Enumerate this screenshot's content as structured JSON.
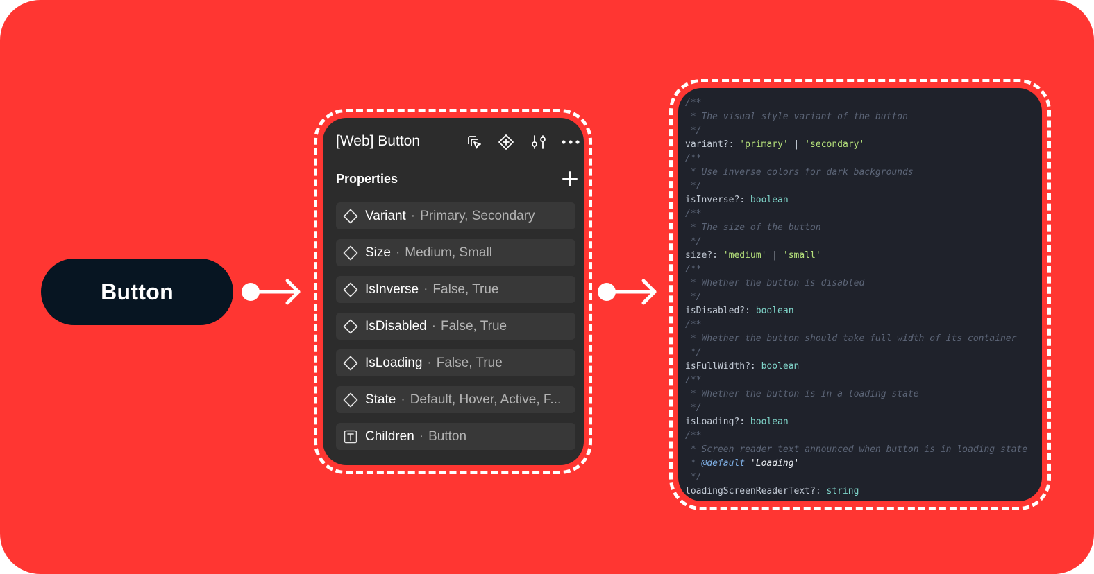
{
  "colors": {
    "background": "#ff3632",
    "button_bg": "#071522",
    "panel_bg": "#2c2c2c",
    "row_bg": "#383838",
    "code_bg": "#1f222b",
    "comment": "#5c6577",
    "string": "#b5e07b",
    "type": "#7fd4c9"
  },
  "demo_button": {
    "label": "Button"
  },
  "panel": {
    "title": "[Web] Button",
    "section_title": "Properties",
    "toolbar_icons": [
      "select-instance-icon",
      "component-icon",
      "adjust-icon",
      "more-icon"
    ],
    "properties": [
      {
        "icon": "diamond-icon",
        "name": "Variant",
        "values": "Primary, Secondary"
      },
      {
        "icon": "diamond-icon",
        "name": "Size",
        "values": "Medium, Small"
      },
      {
        "icon": "diamond-icon",
        "name": "IsInverse",
        "values": "False, True"
      },
      {
        "icon": "diamond-icon",
        "name": "IsDisabled",
        "values": "False, True"
      },
      {
        "icon": "diamond-icon",
        "name": "IsLoading",
        "values": "False, True"
      },
      {
        "icon": "diamond-icon",
        "name": "State",
        "values": "Default, Hover, Active, F..."
      },
      {
        "icon": "text-icon",
        "name": "Children",
        "values": "Button"
      }
    ],
    "separator": "·"
  },
  "code": [
    {
      "comment_open": "/**",
      "comment": " * The visual style variant of the button",
      "comment_close": " */",
      "prop": "variant?: ",
      "type_parts": [
        "'primary'",
        " | ",
        "'secondary'"
      ]
    },
    {
      "comment_open": "/**",
      "comment": " * Use inverse colors for dark backgrounds",
      "comment_close": " */",
      "prop": "isInverse?: ",
      "type_parts": [
        "boolean"
      ]
    },
    {
      "comment_open": "/**",
      "comment": " * The size of the button",
      "comment_close": " */",
      "prop": "size?: ",
      "type_parts": [
        "'medium'",
        " | ",
        "'small'"
      ]
    },
    {
      "comment_open": "/**",
      "comment": " * Whether the button is disabled",
      "comment_close": " */",
      "prop": "isDisabled?: ",
      "type_parts": [
        "boolean"
      ]
    },
    {
      "comment_open": "/**",
      "comment": " * Whether the button should take full width of its container",
      "comment_close": " */",
      "prop": "isFullWidth?: ",
      "type_parts": [
        "boolean"
      ]
    },
    {
      "comment_open": "/**",
      "comment": " * Whether the button is in a loading state",
      "comment_close": " */",
      "prop": "isLoading?: ",
      "type_parts": [
        "boolean"
      ]
    },
    {
      "comment_open": "/**",
      "comment": " * Screen reader text announced when button is in loading state",
      "default_prefix": " * ",
      "default_tag": "@default",
      "default_value": " 'Loading'",
      "comment_close": " */",
      "prop": "loadingScreenReaderText?: ",
      "type_parts": [
        "string"
      ]
    }
  ]
}
